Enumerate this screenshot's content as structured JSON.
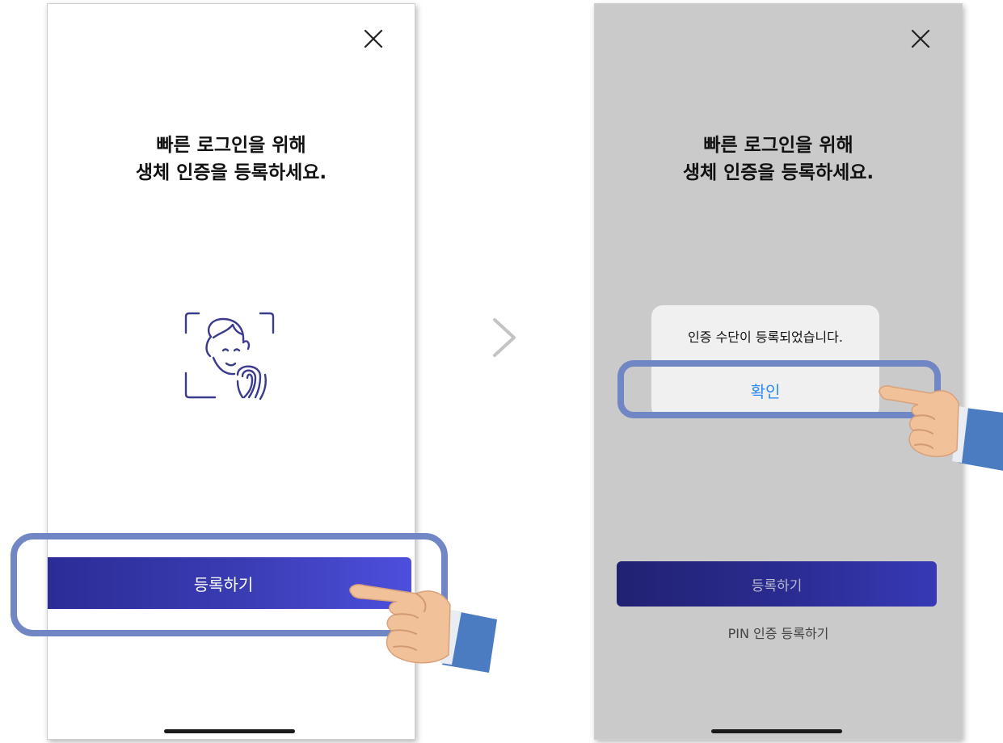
{
  "left_screen": {
    "title_line1": "빠른 로그인을 위해",
    "title_line2": "생체 인증을 등록하세요.",
    "close_icon": "close-icon",
    "illustration_icon": "face-fingerprint-icon",
    "register_button": "등록하기"
  },
  "right_screen": {
    "title_line1": "빠른 로그인을 위해",
    "title_line2": "생체 인증을 등록하세요.",
    "close_icon": "close-icon",
    "dialog": {
      "message": "인증 수단이 등록되었습니다.",
      "confirm_button": "확인"
    },
    "register_button": "등록하기",
    "pin_link": "PIN 인증 등록하기"
  },
  "colors": {
    "accent": "#3a3cb3",
    "highlight": "#7186c4",
    "dialog_button": "#2c8cf4",
    "overlay": "#cacaca"
  },
  "icons": {
    "arrow": "chevron-right-icon",
    "pointer": "pointing-hand-icon"
  }
}
